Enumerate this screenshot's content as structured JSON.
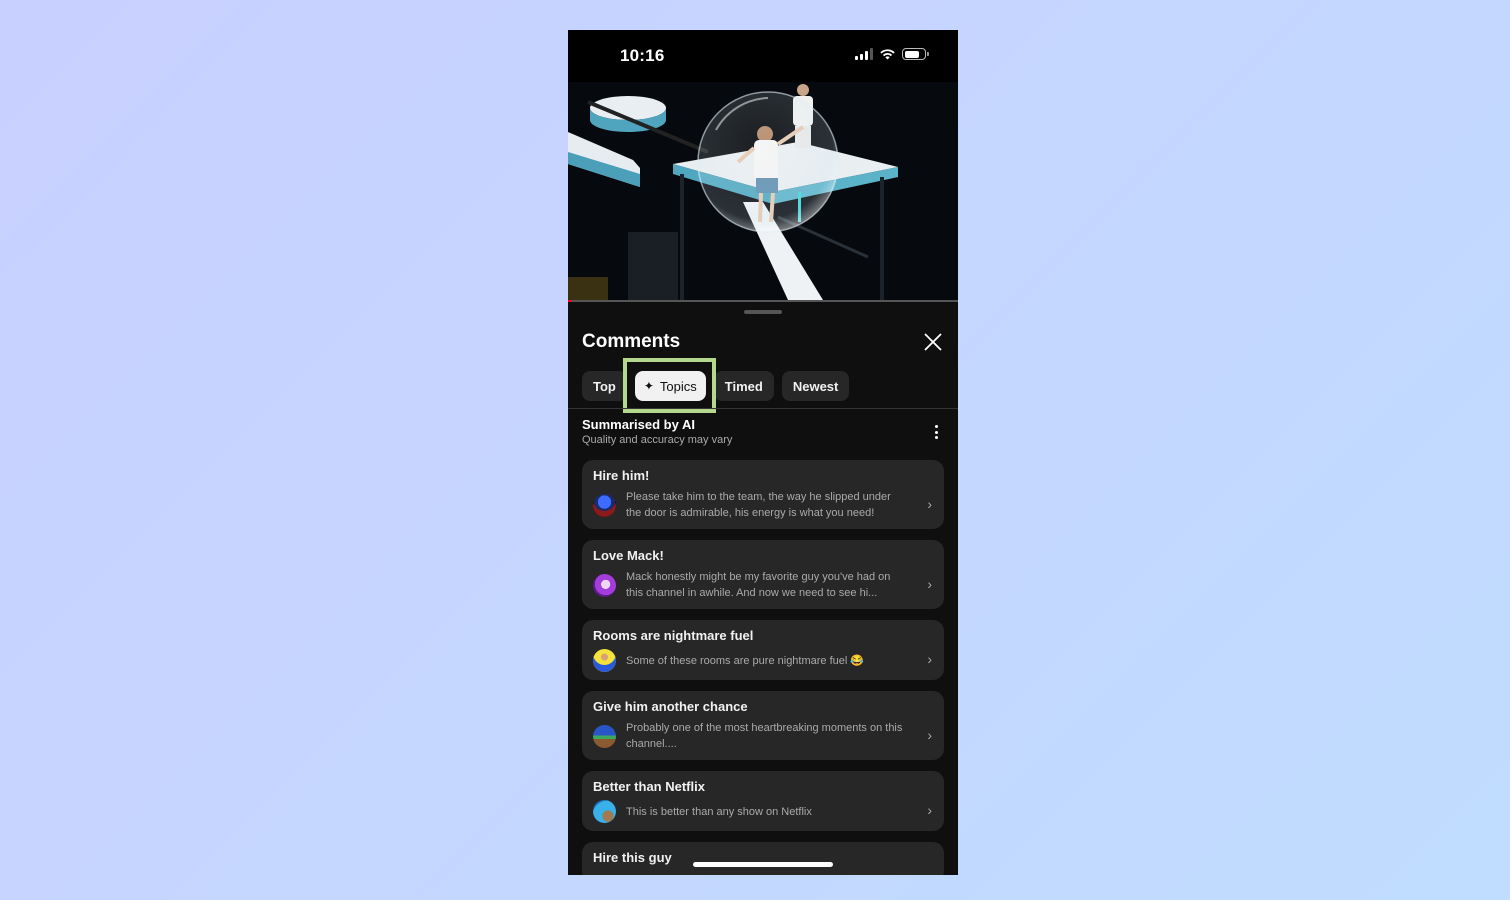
{
  "status_bar": {
    "time": "10:16",
    "icons": [
      "cellular-signal-icon",
      "wifi-icon",
      "battery-icon"
    ]
  },
  "video": {
    "description": "Two men on a white elevated platform; one inside a large transparent bubble",
    "progress_fraction": 0.01,
    "progress_color": "#ff0033"
  },
  "comments": {
    "title": "Comments",
    "close_icon": "close-icon",
    "filters": [
      {
        "label": "Top",
        "active": false
      },
      {
        "label": "Topics",
        "active": true,
        "icon": "sparkle-icon",
        "icon_glyph": "✦"
      },
      {
        "label": "Timed",
        "active": false
      },
      {
        "label": "Newest",
        "active": false
      }
    ],
    "highlight_color": "#b5d98c",
    "summary": {
      "title": "Summarised by AI",
      "subtitle": "Quality and accuracy may vary",
      "menu_icon": "more-vertical-icon"
    },
    "topics": [
      {
        "title": "Hire him!",
        "text": "Please take him to the team, the way he slipped under the door is admirable, his energy is what you need!",
        "avatar": "avatar-robot"
      },
      {
        "title": "Love Mack!",
        "text": "Mack honestly might be my favorite guy you've had on this channel in awhile. And now we need to see hi...",
        "avatar": "avatar-purple-anime"
      },
      {
        "title": "Rooms are nightmare fuel",
        "text": "Some of these rooms are pure nightmare fuel 😂",
        "avatar": "avatar-yellow-person"
      },
      {
        "title": "Give him another chance",
        "text": "Probably one of the most heartbreaking moments on this channel....",
        "avatar": "avatar-landscape"
      },
      {
        "title": "Better than Netflix",
        "text": "This is better than any show on Netflix",
        "avatar": "avatar-earth"
      },
      {
        "title": "Hire this guy",
        "text": "",
        "avatar": ""
      }
    ],
    "chevron_glyph": "›"
  },
  "colors": {
    "background_start": "#c8d0ff",
    "background_end": "#c0dcff",
    "sheet": "#0f0f0f",
    "card": "#272727",
    "text_primary": "#f1f1f1",
    "text_secondary": "#aaaaaa"
  }
}
